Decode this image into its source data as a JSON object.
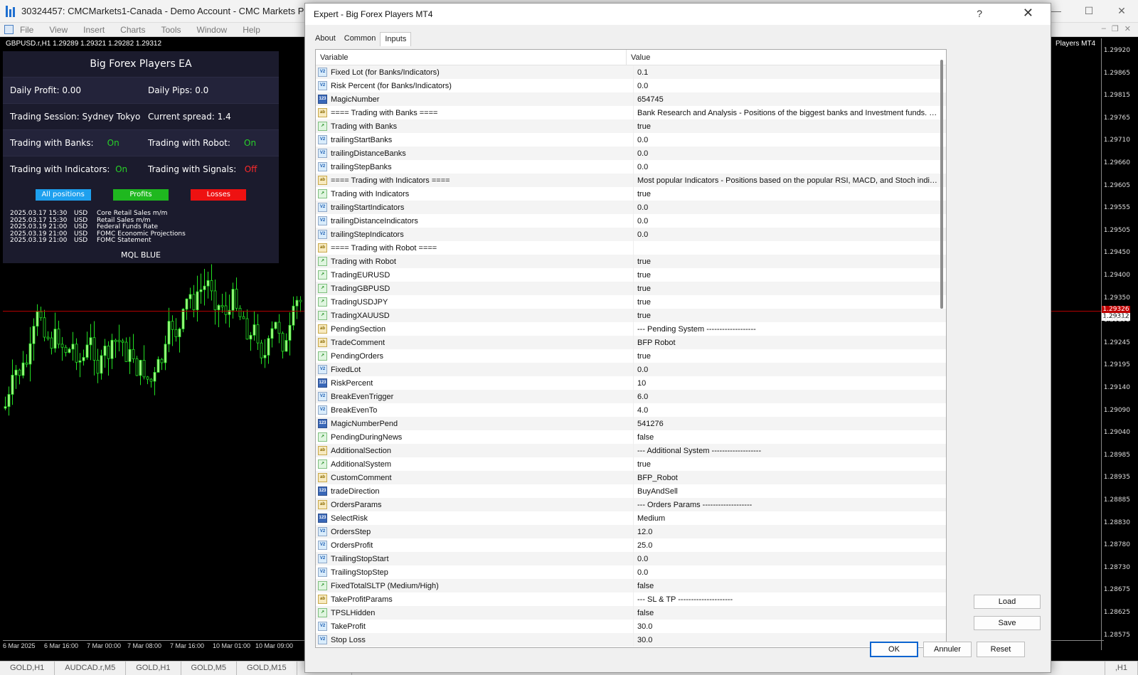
{
  "main_window": {
    "title": "30324457: CMCMarkets1-Canada - Demo Account - CMC Markets Plc - [GBPUSD",
    "menu": [
      "File",
      "View",
      "Insert",
      "Charts",
      "Tools",
      "Window",
      "Help"
    ]
  },
  "chart": {
    "symbol_line": "GBPUSD.r,H1  1.29289 1.29321 1.29282 1.29312",
    "right_label": "Players MT4",
    "price_ticks": [
      "1.29920",
      "1.29865",
      "1.29815",
      "1.29765",
      "1.29710",
      "1.29660",
      "1.29605",
      "1.29555",
      "1.29505",
      "1.29450",
      "1.29400",
      "1.29350",
      "1.29295",
      "1.29245",
      "1.29195",
      "1.29140",
      "1.29090",
      "1.29040",
      "1.28985",
      "1.28935",
      "1.28885",
      "1.28830",
      "1.28780",
      "1.28730",
      "1.28675",
      "1.28625",
      "1.28575"
    ],
    "current_price_a": "1.29326",
    "current_price_b": "1.29312",
    "time_ticks": [
      "6 Mar 2025",
      "6 Mar 16:00",
      "7 Mar 00:00",
      "7 Mar 08:00",
      "7 Mar 16:00",
      "10 Mar 01:00",
      "10 Mar 09:00"
    ]
  },
  "panel": {
    "title": "Big Forex Players EA",
    "daily_profit": "Daily Profit: 0.00",
    "daily_pips": "Daily Pips:  0.0",
    "session": "Trading Session: Sydney Tokyo",
    "spread": "Current spread: 1.4",
    "banks_label": "Trading with Banks:",
    "banks_state": "On",
    "robot_label": "Trading with Robot:",
    "robot_state": "On",
    "indicators_label": "Trading with Indicators:",
    "indicators_state": "On",
    "signals_label": "Trading with Signals:",
    "signals_state": "Off",
    "buttons": {
      "all": "All positions",
      "profits": "Profits",
      "losses": "Losses"
    },
    "news": [
      {
        "date": "2025.03.17 15:30",
        "cur": "USD",
        "event": "Core Retail Sales m/m"
      },
      {
        "date": "2025.03.17 15:30",
        "cur": "USD",
        "event": "Retail Sales m/m"
      },
      {
        "date": "2025.03.19 21:00",
        "cur": "USD",
        "event": "Federal Funds Rate"
      },
      {
        "date": "2025.03.19 21:00",
        "cur": "USD",
        "event": "FOMC Economic Projections"
      },
      {
        "date": "2025.03.19 21:00",
        "cur": "USD",
        "event": "FOMC Statement"
      }
    ],
    "brand": "MQL BLUE",
    "colors": {
      "on": "#28d228",
      "off": "#ff2a2a",
      "all_btn": "#1ea0ee",
      "profit_btn": "#1fb81f",
      "loss_btn": "#ee1111"
    }
  },
  "bottom_tabs": [
    "GOLD,H1",
    "AUDCAD.r,M5",
    "GOLD,H1",
    "GOLD,M5",
    "GOLD,M15",
    "GOLD,H1"
  ],
  "bottom_right_tab": ",H1",
  "dialog": {
    "title": "Expert - Big Forex Players MT4",
    "help": "?",
    "close": "✕",
    "tabs": [
      "About",
      "Common",
      "Inputs"
    ],
    "columns": {
      "variable": "Variable",
      "value": "Value"
    },
    "rows": [
      {
        "type": "double",
        "name": "Fixed Lot (for Banks/Indicators)",
        "value": "0.1"
      },
      {
        "type": "double",
        "name": "Risk Percent (for Banks/Indicators)",
        "value": "0.0"
      },
      {
        "type": "int",
        "name": "MagicNumber",
        "value": "654745"
      },
      {
        "type": "str",
        "name": "==== Trading with Banks ====",
        "value": "Bank Research and Analysis - Positions of the biggest banks and Investment funds. EA only ope..."
      },
      {
        "type": "bool",
        "name": "Trading with Banks",
        "value": "true"
      },
      {
        "type": "double",
        "name": "trailingStartBanks",
        "value": "0.0"
      },
      {
        "type": "double",
        "name": "trailingDistanceBanks",
        "value": "0.0"
      },
      {
        "type": "double",
        "name": "trailingStepBanks",
        "value": "0.0"
      },
      {
        "type": "str",
        "name": "==== Trading with Indicators ====",
        "value": "Most popular Indicators - Positions based on the popular RSI, MACD, and Stoch indicators, H4-..."
      },
      {
        "type": "bool",
        "name": "Trading with Indicators",
        "value": "true"
      },
      {
        "type": "double",
        "name": "trailingStartIndicators",
        "value": "0.0"
      },
      {
        "type": "double",
        "name": "trailingDistanceIndicators",
        "value": "0.0"
      },
      {
        "type": "double",
        "name": "trailingStepIndicators",
        "value": "0.0"
      },
      {
        "type": "str",
        "name": "==== Trading with Robot ====",
        "value": ""
      },
      {
        "type": "bool",
        "name": "Trading with Robot",
        "value": "true"
      },
      {
        "type": "bool",
        "name": "TradingEURUSD",
        "value": "true"
      },
      {
        "type": "bool",
        "name": "TradingGBPUSD",
        "value": "true"
      },
      {
        "type": "bool",
        "name": "TradingUSDJPY",
        "value": "true"
      },
      {
        "type": "bool",
        "name": "TradingXAUUSD",
        "value": "true"
      },
      {
        "type": "str",
        "name": "PendingSection",
        "value": "--- Pending System -------------------"
      },
      {
        "type": "str",
        "name": "TradeComment",
        "value": "BFP Robot"
      },
      {
        "type": "bool",
        "name": "PendingOrders",
        "value": "true"
      },
      {
        "type": "double",
        "name": "FixedLot",
        "value": "0.0"
      },
      {
        "type": "int",
        "name": "RiskPercent",
        "value": "10"
      },
      {
        "type": "double",
        "name": "BreakEvenTrigger",
        "value": "6.0"
      },
      {
        "type": "double",
        "name": "BreakEvenTo",
        "value": "4.0"
      },
      {
        "type": "int",
        "name": "MagicNumberPend",
        "value": "541276"
      },
      {
        "type": "bool",
        "name": "PendingDuringNews",
        "value": "false"
      },
      {
        "type": "str",
        "name": "AdditionalSection",
        "value": "--- Additional System -------------------"
      },
      {
        "type": "bool",
        "name": "AdditionalSystem",
        "value": "true"
      },
      {
        "type": "str",
        "name": "CustomComment",
        "value": "BFP_Robot"
      },
      {
        "type": "int",
        "name": "tradeDirection",
        "value": "BuyAndSell"
      },
      {
        "type": "str",
        "name": "OrdersParams",
        "value": "--- Orders Params -------------------"
      },
      {
        "type": "int",
        "name": "SelectRisk",
        "value": "Medium"
      },
      {
        "type": "double",
        "name": "OrdersStep",
        "value": "12.0"
      },
      {
        "type": "double",
        "name": "OrdersProfit",
        "value": "25.0"
      },
      {
        "type": "double",
        "name": "TrailingStopStart",
        "value": "0.0"
      },
      {
        "type": "double",
        "name": "TrailingStopStep",
        "value": "0.0"
      },
      {
        "type": "bool",
        "name": "FixedTotalSLTP (Medium/High)",
        "value": "false"
      },
      {
        "type": "str",
        "name": "TakeProfitParams",
        "value": "--- SL & TP ---------------------"
      },
      {
        "type": "bool",
        "name": "TPSLHidden",
        "value": "false"
      },
      {
        "type": "double",
        "name": "TakeProfit",
        "value": "30.0"
      },
      {
        "type": "double",
        "name": "Stop Loss",
        "value": "30.0"
      }
    ],
    "buttons": {
      "load": "Load",
      "save": "Save",
      "ok": "OK",
      "cancel": "Annuler",
      "reset": "Reset"
    }
  }
}
